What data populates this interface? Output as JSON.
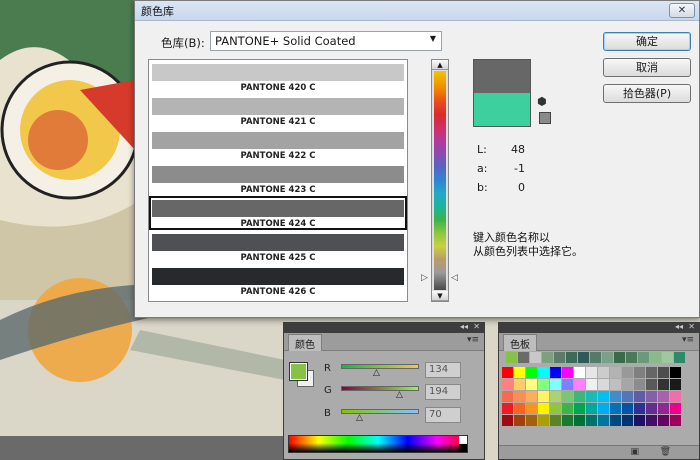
{
  "dialog": {
    "title": "颜色库",
    "close_glyph": "✕",
    "book_label": "色库(B):",
    "book_value": "PANTONE+ Solid Coated",
    "swatches": [
      {
        "name": "PANTONE 420 C",
        "color": "#c8c8c8"
      },
      {
        "name": "PANTONE 421 C",
        "color": "#b4b4b4"
      },
      {
        "name": "PANTONE 422 C",
        "color": "#a3a3a3"
      },
      {
        "name": "PANTONE 423 C",
        "color": "#8c8c8c"
      },
      {
        "name": "PANTONE 424 C",
        "color": "#676767"
      },
      {
        "name": "PANTONE 425 C",
        "color": "#4e5053"
      },
      {
        "name": "PANTONE 426 C",
        "color": "#262a2d"
      }
    ],
    "selected_index": 4,
    "preview": {
      "current": "#676767",
      "original": "#3ecf9e"
    },
    "lab": [
      {
        "key": "L:",
        "value": "48"
      },
      {
        "key": "a:",
        "value": "-1"
      },
      {
        "key": "b:",
        "value": "0"
      }
    ],
    "hint_line1": "键入颜色名称以",
    "hint_line2": "从颜色列表中选择它。",
    "buttons": {
      "ok": "确定",
      "cancel": "取消",
      "picker": "拾色器(P)"
    }
  },
  "color_panel": {
    "tab": "颜色",
    "channels": [
      {
        "label": "R",
        "value": "134",
        "gradient": "linear-gradient(90deg,#00c246,#ffc246)"
      },
      {
        "label": "G",
        "value": "194",
        "gradient": "linear-gradient(90deg,#860046,#86ff46)"
      },
      {
        "label": "B",
        "value": "70",
        "gradient": "linear-gradient(90deg,#86c200,#86c2ff)"
      }
    ],
    "foreground": "#86c246"
  },
  "swatches_panel": {
    "tab": "色板"
  }
}
